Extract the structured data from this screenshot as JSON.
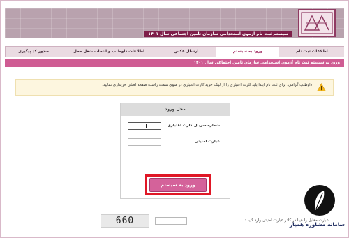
{
  "header": {
    "title": "سیستم ثبت نام آزمون استخدامی سازمان تامین اجتماعی سال ۱۴۰۱"
  },
  "tabs": [
    {
      "label": "اطلاعات ثبت نام",
      "active": false
    },
    {
      "label": "ورود به سیستم",
      "active": true
    },
    {
      "label": "ارسال عکس",
      "active": false
    },
    {
      "label": "اطلاعات داوطلب و انتخاب شغل محل",
      "active": false
    },
    {
      "label": "صدور کد پیگیری",
      "active": false
    }
  ],
  "status_band": {
    "text": "ورود به سیستم ثبت نام آزمون استخدامی سازمان تامین اجتماعی سال ۱۴۰۱"
  },
  "notice": {
    "icon": "warning-icon",
    "text": "داوطلب گرامی، برای ثبت نام ابتدا باید کارت اعتباری را از لینک خرید کارت اعتباری در منوی سمت راست صفحه اصلی خریداری نمایید."
  },
  "login": {
    "title": "محل ورود",
    "serial_label": "شماره سریال کارت اعتباری",
    "serial_value": "",
    "security_label": "عبارت امنیتی",
    "security_value": "",
    "submit_label": "ورود به سیستم"
  },
  "captcha": {
    "label": "عبارت مقابل را عینا در کادر عبارت امنیتی وارد کنید :",
    "code": "660"
  },
  "watermark": {
    "text": "سامانه مشاوره همیار"
  },
  "colors": {
    "brand": "#7e1e49",
    "band": "#cf5c93",
    "button": "#d4629a",
    "highlight": "#e01726"
  }
}
